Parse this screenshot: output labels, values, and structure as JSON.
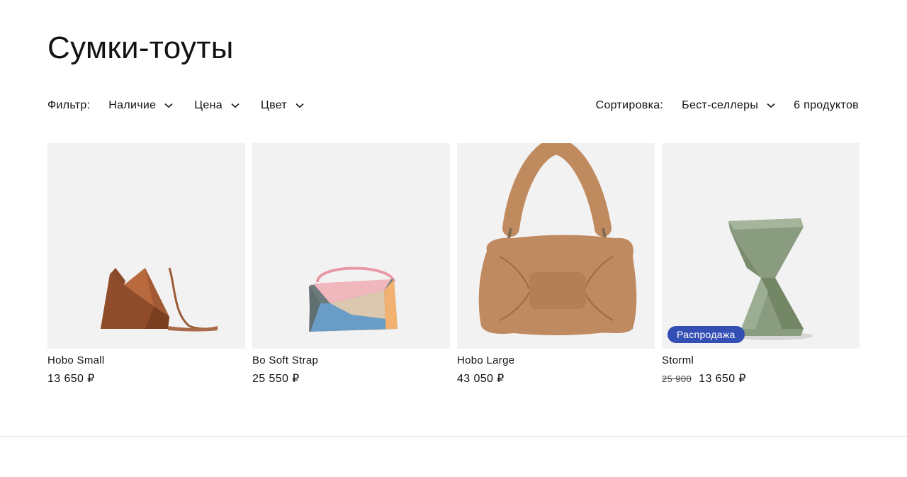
{
  "page": {
    "title": "Сумки-тоуты"
  },
  "filters": {
    "label": "Фильтр:",
    "items": [
      {
        "label": "Наличие"
      },
      {
        "label": "Цена"
      },
      {
        "label": "Цвет"
      }
    ]
  },
  "sort": {
    "label": "Сортировка:",
    "selected": "Бест-селлеры"
  },
  "product_count": "6 продуктов",
  "products": [
    {
      "name": "Hobo Small",
      "price": "13 650 ₽",
      "image": "brown-triangle-bag"
    },
    {
      "name": "Bo Soft Strap",
      "price": "25 550 ₽",
      "image": "colorblock-bag"
    },
    {
      "name": "Hobo Large",
      "price": "43 050 ₽",
      "image": "puffy-tan-bag"
    },
    {
      "name": "Storml",
      "price_old": "25 900",
      "price": "13 650 ₽",
      "badge": "Распродажа",
      "image": "green-twisted-bag"
    }
  ],
  "colors": {
    "accent": "#334fb4",
    "card_bg": "#f3f2f2"
  }
}
